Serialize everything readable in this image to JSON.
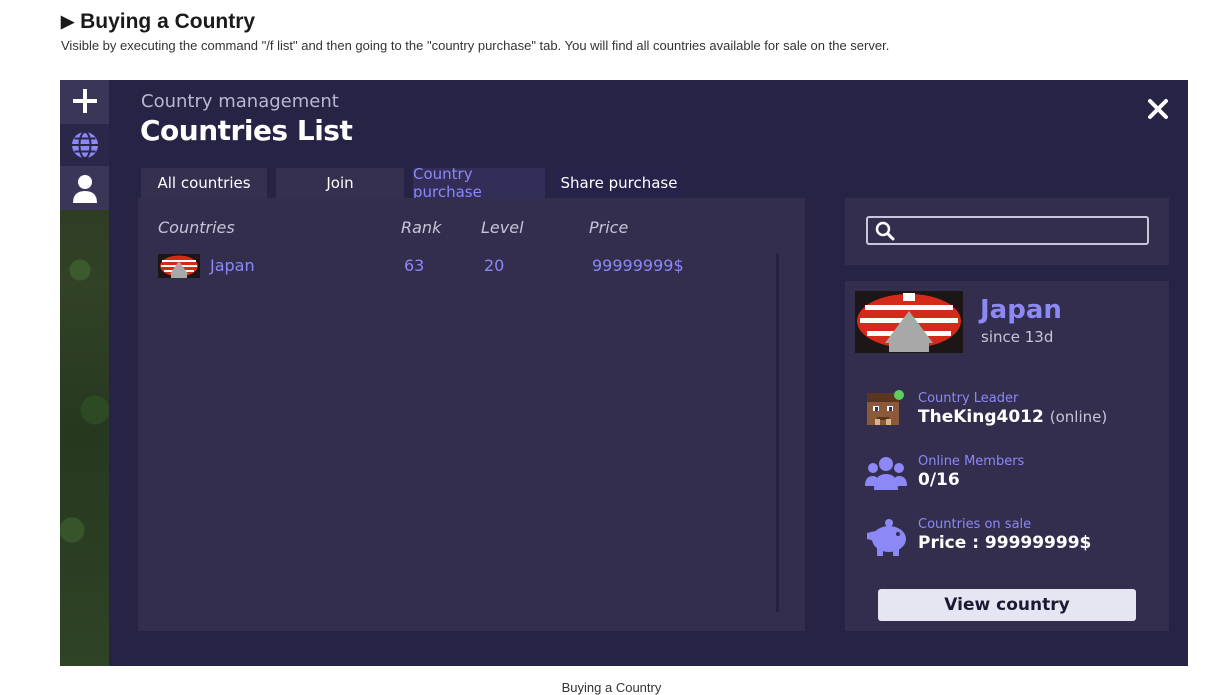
{
  "doc": {
    "title_marker": "▶",
    "title": "Buying a Country",
    "description": "Visible by executing the command \"/f list\" and then going to the \"country purchase\" tab. You will find all countries available for sale on the server.",
    "caption": "Buying a Country"
  },
  "sidebar": {
    "items": [
      {
        "icon": "plus-icon"
      },
      {
        "icon": "globe-icon",
        "active": true
      },
      {
        "icon": "user-icon"
      }
    ]
  },
  "header": {
    "subtitle": "Country management",
    "title": "Countries List"
  },
  "tabs": [
    {
      "label": "All countries"
    },
    {
      "label": "Join"
    },
    {
      "label": "Country purchase",
      "active": true
    },
    {
      "label": "Share purchase"
    }
  ],
  "table": {
    "columns": [
      "Countries",
      "Rank",
      "Level",
      "Price"
    ],
    "rows": [
      {
        "country": "Japan",
        "rank": "63",
        "level": "20",
        "price": "99999999$"
      }
    ]
  },
  "search": {
    "icon": "search-icon"
  },
  "details": {
    "name": "Japan",
    "since": "since 13d",
    "leader_label": "Country Leader",
    "leader_name": "TheKing4012",
    "leader_status": "(online)",
    "members_label": "Online Members",
    "members_value": "0/16",
    "sale_label": "Countries on sale",
    "sale_value": "Price : 99999999$",
    "view_button": "View country"
  },
  "colors": {
    "background": "#262345",
    "panel": "#332e4e",
    "accent": "#8c88f5",
    "online_dot": "#5fce5b"
  }
}
